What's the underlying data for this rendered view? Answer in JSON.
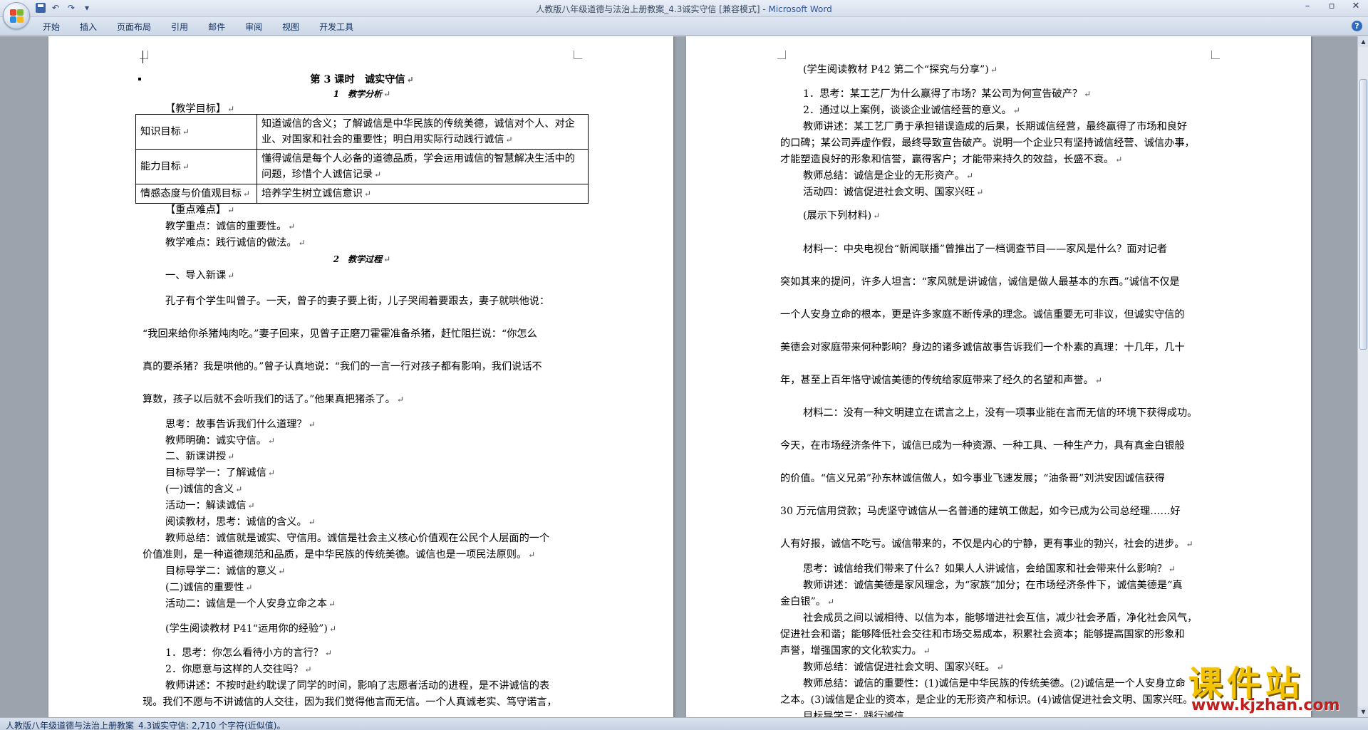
{
  "window": {
    "title": "人教版八年级道德与法治上册教案_4.3诚实守信 [兼容模式]",
    "app": " - Microsoft Word"
  },
  "quick_access": {
    "undo": "↶",
    "redo": "↷",
    "more": "▾"
  },
  "window_controls": {
    "minimize": "–",
    "maximize": "▫",
    "close": "✕"
  },
  "ribbon": {
    "tabs": [
      "开始",
      "插入",
      "页面布局",
      "引用",
      "邮件",
      "审阅",
      "视图",
      "开发工具"
    ],
    "help": "?"
  },
  "status_bar": {
    "text": "人教版八年级道德与法治上册教案_4.3诚实守信: 2,710 个字符(近似值)。"
  },
  "mark": "↵",
  "left_page": {
    "title": "第 3 课时　诚实守信",
    "section1": "1　教学分析",
    "goals_label": "【教学目标】",
    "goals": [
      {
        "key": "知识目标",
        "value": "知道诚信的含义；了解诚信是中华民族的传统美德，诚信对个人、对企业、对国家和社会的重要性；明白用实际行动践行诚信"
      },
      {
        "key": "能力目标",
        "value": "懂得诚信是每个人必备的道德品质，学会运用诚信的智慧解决生活中的问题，珍惜个人诚信记录"
      },
      {
        "key": "情感态度与价值观目标",
        "value": "培养学生树立诚信意识"
      }
    ],
    "key_label": "【重点难点】",
    "key_point": "教学重点：诚信的重要性。",
    "difficult_point": "教学难点：践行诚信的做法。",
    "section2": "2　教学过程",
    "lines": [
      "一、导入新课",
      "孔子有个学生叫曾子。一天，曾子的妻子要上街，儿子哭闹着要跟去，妻子就哄他说：",
      "“我回来给你杀猪炖肉吃。”妻子回来，见曾子正磨刀霍霍准备杀猪，赶忙阻拦说：“你怎么",
      "真的要杀猪？我是哄他的。”曾子认真地说：“我们的一言一行对孩子都有影响，我们说话不",
      "算数，孩子以后就不会听我们的话了。”他果真把猪杀了。",
      "思考：故事告诉我们什么道理？",
      "教师明确：诚实守信。",
      "二、新课讲授",
      "目标导学一：了解诚信",
      "(一)诚信的含义",
      "活动一：解读诚信",
      "阅读教材，思考：诚信的含义。",
      "教师总结：诚信就是诚实、守信用。诚信是社会主义核心价值观在公民个人层面的一个",
      "价值准则，是一种道德规范和品质，是中华民族的传统美德。诚信也是一项民法原则。",
      "目标导学二：诚信的意义",
      "(二)诚信的重要性",
      "活动二：诚信是一个人安身立命之本",
      "(学生阅读教材 P41“运用你的经验”)",
      "1．思考：你怎么看待小方的言行？",
      "2．你愿意与这样的人交往吗？",
      "教师讲述：不按时赴约耽误了同学的时间，影响了志愿者活动的进程，是不讲诚信的表",
      "现。我们不愿与不讲诚信的人交往，因为我们觉得他言而无信。一个人真诚老实、笃守诺言，"
    ]
  },
  "right_page": {
    "lines": [
      "(学生阅读教材 P42 第二个“探究与分享”)",
      "1．思考：某工艺厂为什么赢得了市场？某公司为何宣告破产？",
      "2．通过以上案例，谈谈企业诚信经营的意义。",
      "教师讲述：某工艺厂勇于承担错误造成的后果，长期诚信经营，最终赢得了市场和良好",
      "的口碑；某公司弄虚作假，最终导致宣告破产。说明一个企业只有坚持诚信经营、诚信办事，",
      "才能塑造良好的形象和信誉，赢得客户；才能带来持久的效益，长盛不衰。",
      "教师总结：诚信是企业的无形资产。",
      "活动四：诚信促进社会文明、国家兴旺",
      "(展示下列材料)",
      "材料一：中央电视台“新闻联播”曾推出了一档调查节目——家风是什么？面对记者",
      "突如其来的提问，许多人坦言：“家风就是讲诚信，诚信是做人最基本的东西。”诚信不仅是",
      "一个人安身立命的根本，更是许多家庭不断传承的理念。诚信重要无可非议，但诚实守信的",
      "美德会对家庭带来何种影响？身边的诸多诚信故事告诉我们一个朴素的真理：十几年，几十",
      "年，甚至上百年恪守诚信美德的传统给家庭带来了经久的名望和声誉。",
      "材料二：没有一种文明建立在谎言之上，没有一项事业能在言而无信的环境下获得成功。",
      "今天，在市场经济条件下，诚信已成为一种资源、一种工具、一种生产力，具有真金白银般",
      "的价值。“信义兄弟”孙东林诚信做人，如今事业飞速发展；“油条哥”刘洪安因诚信获得",
      "30 万元信用贷款；马虎坚守诚信从一名普通的建筑工做起，如今已成为公司总经理……好",
      "人有好报，诚信不吃亏。诚信带来的，不仅是内心的宁静，更有事业的勃兴，社会的进步。",
      "思考：诚信给我们带来了什么？如果人人讲诚信，会给国家和社会带来什么影响？",
      "教师讲述：诚信美德是家风理念，为“家族”加分；在市场经济条件下，诚信美德是“真",
      "金白银”。",
      "社会成员之间以诚相待、以信为本，能够增进社会互信，减少社会矛盾，净化社会风气，",
      "促进社会和谐；能够降低社会交往和市场交易成本，积累社会资本；能够提高国家的形象和",
      "声誉，增强国家的文化软实力。",
      "教师总结：诚信促进社会文明、国家兴旺。",
      "教师总结：诚信的重要性：(1)诚信是中华民族的传统美德。(2)诚信是一个人安身立命",
      "之本。(3)诚信是企业的资本，是企业的无形资产和标识。(4)诚信促进社会文明、国家兴旺。",
      "目标导学三：践行诚信"
    ]
  },
  "watermark": {
    "title": "课件站",
    "url": "www.kjzhan.com"
  }
}
